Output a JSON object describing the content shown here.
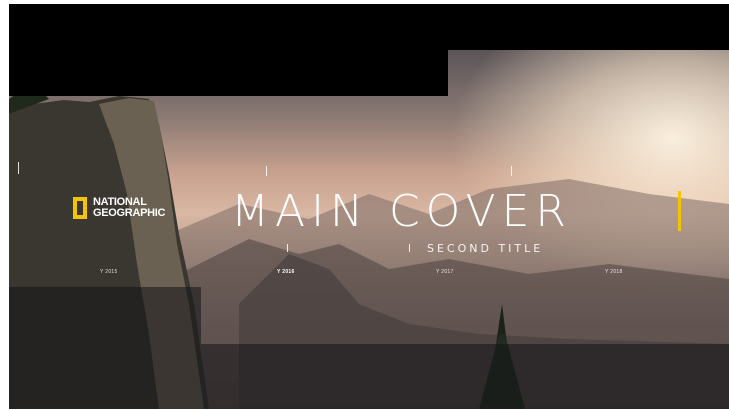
{
  "logo": {
    "line1": "NATIONAL",
    "line2": "GEOGRAPHIC",
    "accent": "#f5c400"
  },
  "main_title": "MAIN COVER",
  "sub_title": "SECOND TITLE",
  "timeline": {
    "years": [
      "Y 2015",
      "Y 2016",
      "Y 2017",
      "Y 2018"
    ],
    "active_index": 1
  },
  "colors": {
    "accent": "#f5c400",
    "text": "#ffffff",
    "background": "#000000"
  }
}
